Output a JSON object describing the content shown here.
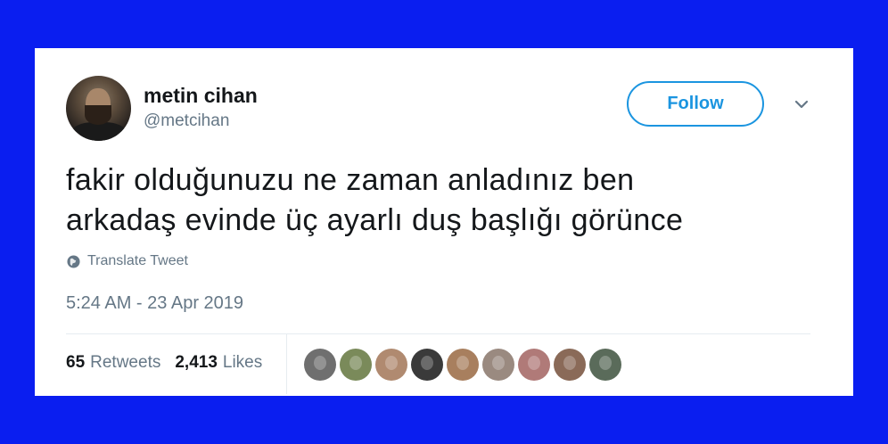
{
  "user": {
    "display_name": "metin cihan",
    "handle": "@metcihan"
  },
  "follow_label": "Follow",
  "tweet": {
    "lines": [
      "fakir olduğunuzu ne zaman anladınız ben",
      "arkadaş evinde üç ayarlı duş başlığı görünce"
    ]
  },
  "translate_label": "Translate Tweet",
  "timestamp": "5:24 AM - 23 Apr 2019",
  "stats": {
    "retweets_count": "65",
    "retweets_label": "Retweets",
    "likes_count": "2,413",
    "likes_label": "Likes"
  },
  "colors": {
    "background": "#0a1ef0",
    "accent": "#1b95e0",
    "text_primary": "#14171a",
    "text_secondary": "#657786"
  },
  "icons": {
    "menu": "chevron-down-icon",
    "translate": "globe-icon"
  },
  "liker_avatars": [
    {
      "color": "#6f6f6f"
    },
    {
      "color": "#7a8a5a"
    },
    {
      "color": "#b08a70"
    },
    {
      "color": "#3a3a3a"
    },
    {
      "color": "#a87f5e"
    },
    {
      "color": "#9a8a80"
    },
    {
      "color": "#b07a78"
    },
    {
      "color": "#8a6a58"
    },
    {
      "color": "#5a6b5a"
    }
  ]
}
